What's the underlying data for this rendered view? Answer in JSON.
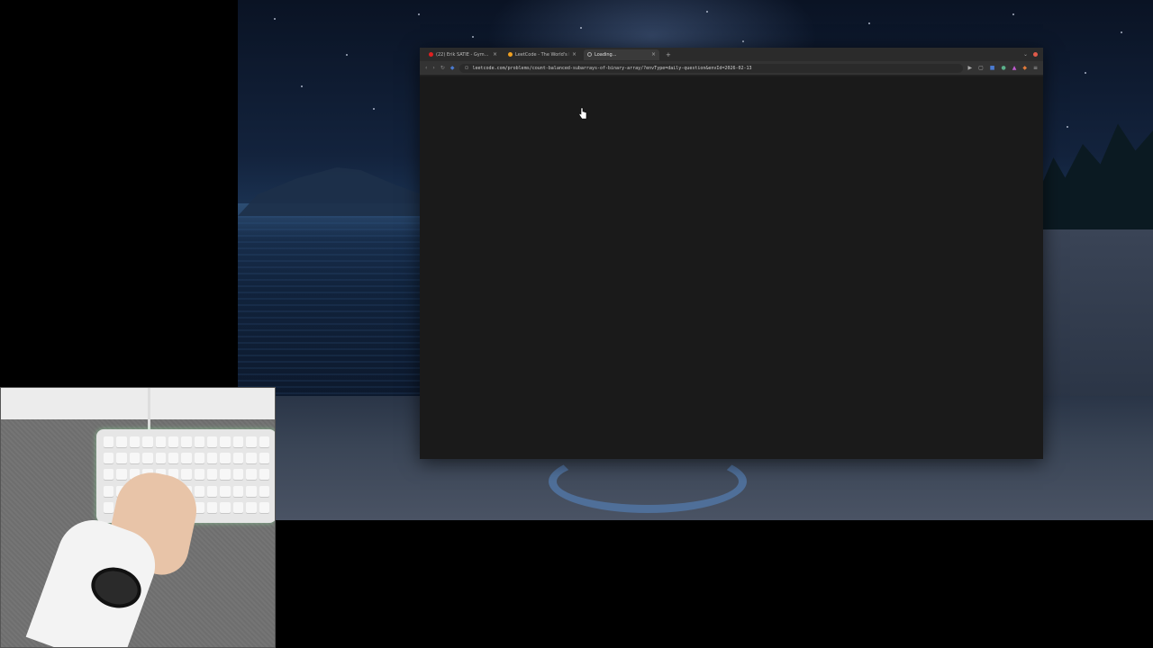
{
  "browser": {
    "tabs": [
      {
        "title": "(22) Erik SATIE - Gym...",
        "favicon": "youtube-icon",
        "color": "#e02020",
        "active": false
      },
      {
        "title": "LeetCode - The World's Le...",
        "favicon": "leetcode-icon",
        "color": "#f0a020",
        "active": false
      },
      {
        "title": "Loading...",
        "favicon": "loading-spinner-icon",
        "color": "#888888",
        "active": true
      }
    ],
    "new_tab_label": "+",
    "url": "leetcode.com/problems/count-balanced-subarrays-of-binary-array/?envType=daily-question&envId=2026-02-13"
  },
  "colors": {
    "page_background": "#1a1a1a",
    "chrome": "#2b2b2b",
    "close_button": "#e05a4a"
  }
}
